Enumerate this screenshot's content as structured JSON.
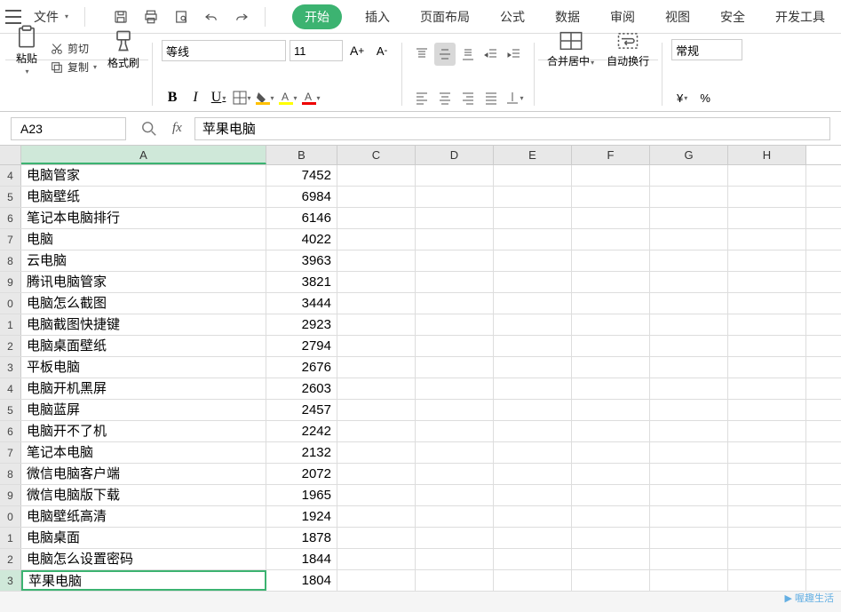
{
  "menu": {
    "file": "文件",
    "tabs": [
      "开始",
      "插入",
      "页面布局",
      "公式",
      "数据",
      "审阅",
      "视图",
      "安全",
      "开发工具"
    ],
    "active_tab": 0
  },
  "clipboard": {
    "paste": "粘贴",
    "cut": "剪切",
    "copy": "复制",
    "format_painter": "格式刷"
  },
  "font": {
    "name": "等线",
    "size": "11"
  },
  "merge": {
    "merge_center": "合并居中",
    "wrap": "自动换行",
    "number_format": "常规"
  },
  "namebox": "A23",
  "formula": "苹果电脑",
  "columns": [
    "A",
    "B",
    "C",
    "D",
    "E",
    "F",
    "G",
    "H"
  ],
  "row_start": 4,
  "selected_row_index": 19,
  "rows": [
    {
      "a": "电脑管家",
      "b": 7452
    },
    {
      "a": "电脑壁纸",
      "b": 6984
    },
    {
      "a": "笔记本电脑排行",
      "b": 6146
    },
    {
      "a": "电脑",
      "b": 4022
    },
    {
      "a": "云电脑",
      "b": 3963
    },
    {
      "a": "腾讯电脑管家",
      "b": 3821
    },
    {
      "a": "电脑怎么截图",
      "b": 3444
    },
    {
      "a": "电脑截图快捷键",
      "b": 2923
    },
    {
      "a": "电脑桌面壁纸",
      "b": 2794
    },
    {
      "a": "平板电脑",
      "b": 2676
    },
    {
      "a": "电脑开机黑屏",
      "b": 2603
    },
    {
      "a": "电脑蓝屏",
      "b": 2457
    },
    {
      "a": "电脑开不了机",
      "b": 2242
    },
    {
      "a": "笔记本电脑",
      "b": 2132
    },
    {
      "a": "微信电脑客户端",
      "b": 2072
    },
    {
      "a": "微信电脑版下载",
      "b": 1965
    },
    {
      "a": "电脑壁纸高清",
      "b": 1924
    },
    {
      "a": "电脑桌面",
      "b": 1878
    },
    {
      "a": "电脑怎么设置密码",
      "b": 1844
    },
    {
      "a": "苹果电脑",
      "b": 1804
    }
  ],
  "watermark": "喔趣生活",
  "percent_sign": "%"
}
